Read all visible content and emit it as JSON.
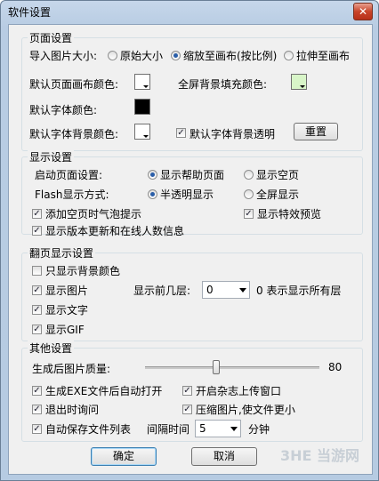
{
  "window": {
    "title": "软件设置",
    "close": "✕"
  },
  "page_settings": {
    "title": "页面设置",
    "import_size_label": "导入图片大小:",
    "size_options": [
      "原始大小",
      "缩放至画布(按比例)",
      "拉伸至画布"
    ],
    "selected_size": 1,
    "default_canvas_color_label": "默认页面画布颜色:",
    "fullscreen_bg_color_label": "全屏背景填充颜色:",
    "default_font_color_label": "默认字体颜色:",
    "default_font_bg_color_label": "默认字体背景颜色:",
    "font_bg_transparent_label": "默认字体背景透明",
    "font_bg_transparent_checked": true,
    "reset_label": "重置",
    "colors": {
      "canvas": "#ffffff",
      "fullscreen": "#d8f5c8",
      "font": "#000000",
      "font_bg": "#ffffff"
    }
  },
  "display_settings": {
    "title": "显示设置",
    "startup_page_label": "启动页面设置:",
    "startup_options": [
      "显示帮助页面",
      "显示空页"
    ],
    "startup_selected": 0,
    "flash_mode_label": "Flash显示方式:",
    "flash_options": [
      "半透明显示",
      "全屏显示"
    ],
    "flash_selected": 0,
    "bubble_tip_label": "添加空页时气泡提示",
    "bubble_tip_checked": true,
    "effect_preview_label": "显示特效预览",
    "effect_preview_checked": true,
    "version_info_label": "显示版本更新和在线人数信息",
    "version_info_checked": true
  },
  "flip_settings": {
    "title": "翻页显示设置",
    "bg_only_label": "只显示背景颜色",
    "bg_only_checked": false,
    "show_image_label": "显示图片",
    "show_image_checked": true,
    "show_layers_label": "显示前几层:",
    "layers_value": "0",
    "layers_hint": "0 表示显示所有层",
    "show_text_label": "显示文字",
    "show_text_checked": true,
    "show_gif_label": "显示GIF",
    "show_gif_checked": true
  },
  "other_settings": {
    "title": "其他设置",
    "quality_label": "生成后图片质量:",
    "quality_value": "80",
    "quality_fraction": 0.8,
    "auto_open_label": "生成EXE文件后自动打开",
    "auto_open_checked": true,
    "upload_window_label": "开启杂志上传窗口",
    "upload_window_checked": true,
    "exit_ask_label": "退出时询问",
    "exit_ask_checked": true,
    "compress_label": "压缩图片,使文件更小",
    "compress_checked": true,
    "autosave_label": "自动保存文件列表",
    "autosave_checked": true,
    "interval_label": "间隔时间",
    "interval_value": "5",
    "interval_unit": "分钟"
  },
  "footer": {
    "ok_label": "确定",
    "cancel_label": "取消",
    "watermark": "3HE 当游网"
  }
}
